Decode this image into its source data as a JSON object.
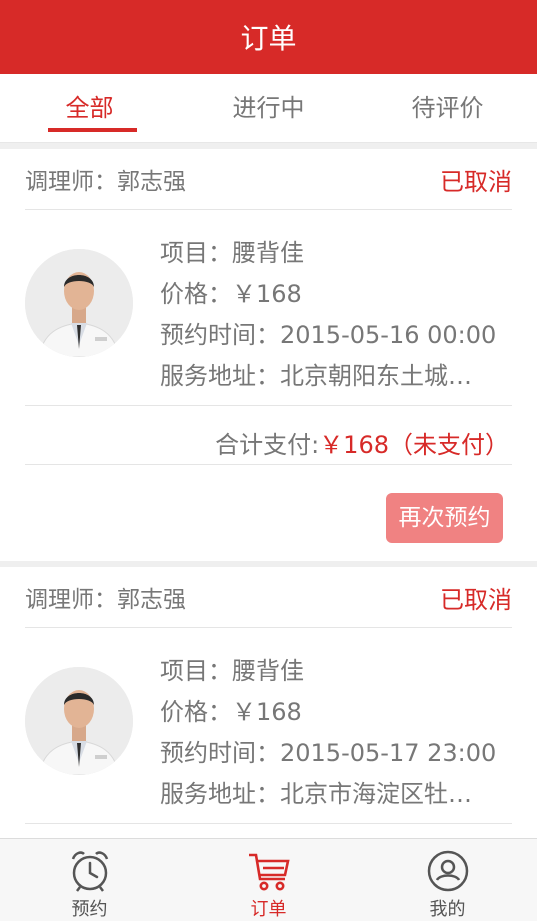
{
  "header": {
    "title": "订单"
  },
  "tabs": [
    {
      "label": "全部"
    },
    {
      "label": "进行中"
    },
    {
      "label": "待评价"
    }
  ],
  "orders": [
    {
      "therapist": "调理师：郭志强",
      "status": "已取消",
      "project_label": "项目：",
      "project": "腰背佳",
      "price_label": "价格：",
      "price": "￥168",
      "time_label": "预约时间：",
      "time": "2015-05-16 00:00",
      "address_label": "服务地址：",
      "address": "北京朝阳东土城…",
      "total_label": "合计支付:",
      "total_amount": "￥168（未支付）",
      "action": "再次预约"
    },
    {
      "therapist": "调理师：郭志强",
      "status": "已取消",
      "project_label": "项目：",
      "project": "腰背佳",
      "price_label": "价格：",
      "price": "￥168",
      "time_label": "预约时间：",
      "time": "2015-05-17 23:00",
      "address_label": "服务地址：",
      "address": "北京市海淀区牡…"
    }
  ],
  "tabbar": [
    {
      "label": "预约",
      "icon": "alarm-clock-icon"
    },
    {
      "label": "订单",
      "icon": "cart-icon"
    },
    {
      "label": "我的",
      "icon": "user-icon"
    }
  ],
  "colors": {
    "brand_red": "#d72a28",
    "button_pink": "#f08282"
  }
}
